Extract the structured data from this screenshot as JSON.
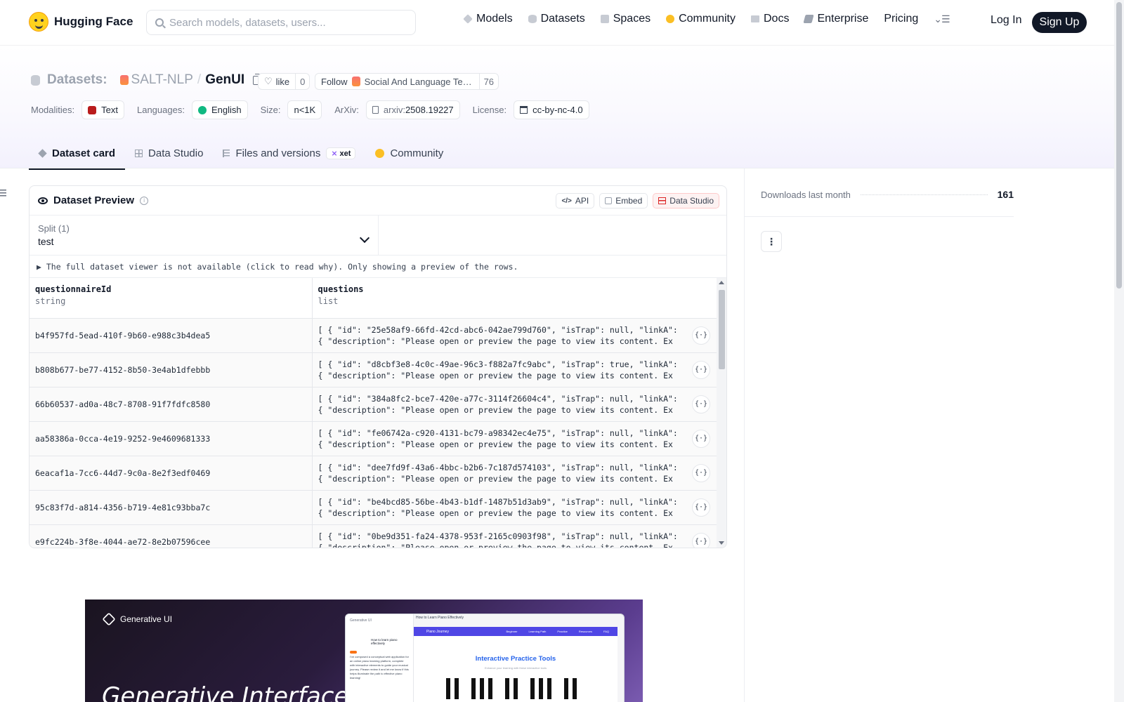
{
  "nav": {
    "logo_text": "Hugging Face",
    "search_placeholder": "Search models, datasets, users...",
    "links": [
      "Models",
      "Datasets",
      "Spaces",
      "Community",
      "Docs",
      "Enterprise",
      "Pricing"
    ],
    "login": "Log In",
    "signup": "Sign Up"
  },
  "repo": {
    "kind": "Datasets:",
    "org": "SALT-NLP",
    "separator": "/",
    "name": "GenUI",
    "like_label": "like",
    "like_count": "0",
    "follow_label": "Follow",
    "follow_org": "Social And Language Technology Lab",
    "follow_count": "76"
  },
  "meta": {
    "modalities_label": "Modalities:",
    "modality": "Text",
    "languages_label": "Languages:",
    "language": "English",
    "size_label": "Size:",
    "size": "n<1K",
    "arxiv_label": "ArXiv:",
    "arxiv_prefix": "arxiv:",
    "arxiv_id": "2508.19227",
    "license_label": "License:",
    "license": "cc-by-nc-4.0"
  },
  "tabs": [
    {
      "label": "Dataset card",
      "active": true
    },
    {
      "label": "Data Studio",
      "active": false
    },
    {
      "label": "Files and versions",
      "active": false,
      "badge": "xet"
    },
    {
      "label": "Community",
      "active": false
    }
  ],
  "preview": {
    "title": "Dataset Preview",
    "btn_api": "API",
    "btn_embed": "Embed",
    "btn_studio": "Data Studio",
    "split_label": "Split (1)",
    "split_value": "test",
    "notice": "▶ The full dataset viewer is not available (click to read why). Only showing a preview of the rows.",
    "columns": [
      {
        "name": "questionnaireId",
        "type": "string"
      },
      {
        "name": "questions",
        "type": "list"
      }
    ],
    "rows": [
      {
        "id": "b4f957fd-5ead-410f-9b60-e988c3b4dea5",
        "q1": "[ { \"id\": \"25e58af9-66fd-42cd-abc6-042ae799d760\", \"isTrap\": null, \"linkA\":",
        "q2": "{ \"description\": \"Please open or preview the page to view its content. Ex"
      },
      {
        "id": "b808b677-be77-4152-8b50-3e4ab1dfebbb",
        "q1": "[ { \"id\": \"d8cbf3e8-4c0c-49ae-96c3-f882a7fc9abc\", \"isTrap\": true, \"linkA\":",
        "q2": "{ \"description\": \"Please open or preview the page to view its content. Ex"
      },
      {
        "id": "66b60537-ad0a-48c7-8708-91f7fdfc8580",
        "q1": "[ { \"id\": \"384a8fc2-bce7-420e-a77c-3114f26604c4\", \"isTrap\": null, \"linkA\":",
        "q2": "{ \"description\": \"Please open or preview the page to view its content. Ex"
      },
      {
        "id": "aa58386a-0cca-4e19-9252-9e4609681333",
        "q1": "[ { \"id\": \"fe06742a-c920-4131-bc79-a98342ec4e75\", \"isTrap\": null, \"linkA\":",
        "q2": "{ \"description\": \"Please open or preview the page to view its content. Ex"
      },
      {
        "id": "6eacaf1a-7cc6-44d7-9c0a-8e2f3edf0469",
        "q1": "[ { \"id\": \"dee7fd9f-43a6-4bbc-b2b6-7c187d574103\", \"isTrap\": null, \"linkA\":",
        "q2": "{ \"description\": \"Please open or preview the page to view its content. Ex"
      },
      {
        "id": "95c83f7d-a814-4356-b719-4e81c93bba7c",
        "q1": "[ { \"id\": \"be4bcd85-56be-4b43-b1df-1487b51d3ab9\", \"isTrap\": null, \"linkA\":",
        "q2": "{ \"description\": \"Please open or preview the page to view its content. Ex"
      },
      {
        "id": "e9fc224b-3f8e-4044-ae72-8e2b07596cee",
        "q1": "[ { \"id\": \"0be9d351-fa24-4378-953f-2165c0903f98\", \"isTrap\": null, \"linkA\":",
        "q2": "{ \"description\": \"Please open or preview the page to view its content. Ex"
      }
    ],
    "json_btn": "{·}"
  },
  "sidebar": {
    "downloads_label": "Downloads last month",
    "downloads_value": "161",
    "menu_glyph": "⋮"
  },
  "banner": {
    "brand": "Generative UI",
    "headline": "Generative Interfaces",
    "mock_sidebar_title": "Generative UI",
    "mock_question": "How to learn piano effectively",
    "mock_answer": "I've composed a conceptual web application for an online piano learning platform, complete with interactive elements to guide your musical journey. Please review it and let me know if this helps illuminate the path to effective piano learning!",
    "mock_page_title": "How to Learn Piano Effectively",
    "mock_brand": "Piano Journey",
    "mock_navs": [
      "Beginner",
      "Learning Path",
      "Practice",
      "Resources",
      "FAQ"
    ],
    "mock_heading": "Interactive Practice Tools",
    "mock_sub": "Enhance your learning with these interactive tools"
  },
  "colors": {
    "accent_dark": "#111827",
    "community": "#fbbf24",
    "studio_red": "#dc2626",
    "mock_bar": "#4f46e5",
    "mock_heading": "#2563eb"
  }
}
